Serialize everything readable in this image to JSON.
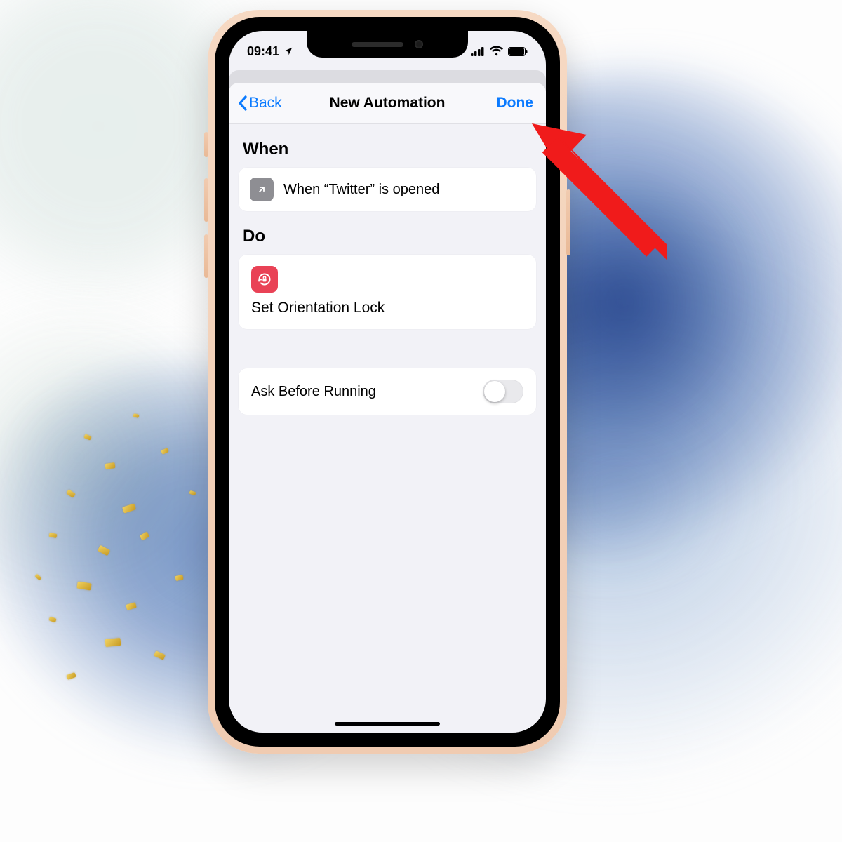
{
  "statusbar": {
    "time": "09:41"
  },
  "nav": {
    "back_label": "Back",
    "title": "New Automation",
    "done_label": "Done"
  },
  "sections": {
    "when_title": "When",
    "do_title": "Do"
  },
  "when": {
    "trigger_text": "When “Twitter” is opened"
  },
  "do": {
    "action_title": "Set Orientation Lock"
  },
  "settings": {
    "ask_before_running_label": "Ask Before Running",
    "ask_before_running_on": false
  },
  "colors": {
    "ios_blue": "#0a7aff",
    "action_red": "#e94256",
    "annotation_red": "#f01b1b"
  }
}
